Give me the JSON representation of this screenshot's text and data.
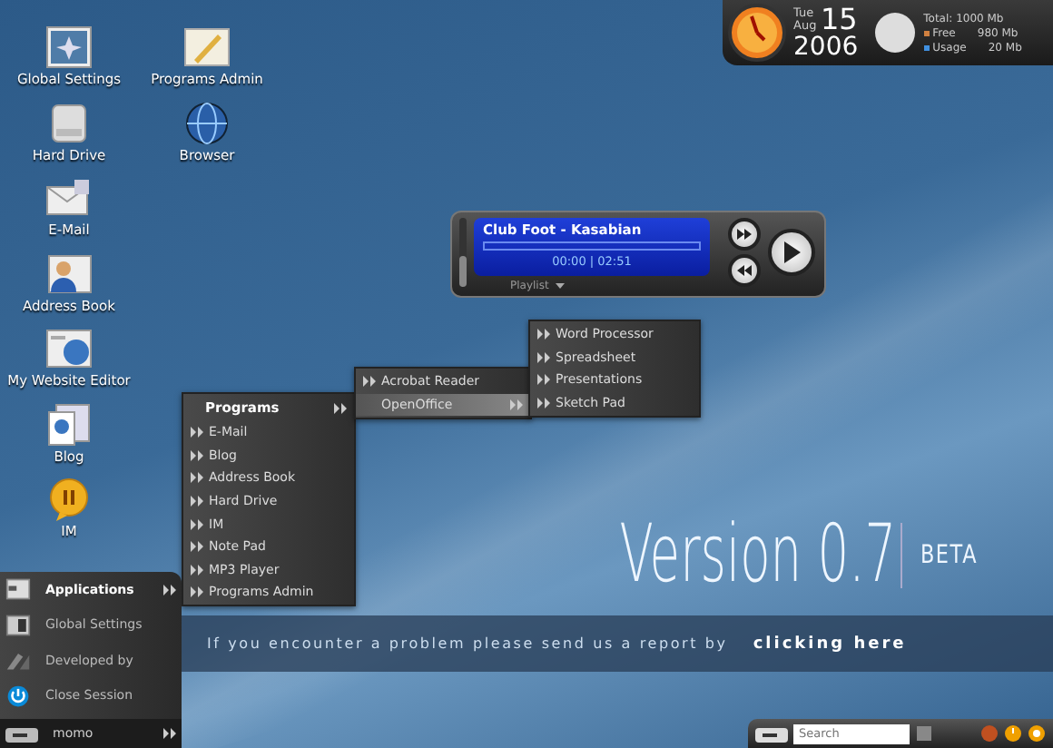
{
  "desktop_icons": [
    {
      "label": "Global Settings",
      "kind": "settings"
    },
    {
      "label": "Hard Drive",
      "kind": "drive"
    },
    {
      "label": "E-Mail",
      "kind": "mail"
    },
    {
      "label": "Address Book",
      "kind": "contacts"
    },
    {
      "label": "My Website Editor",
      "kind": "web"
    },
    {
      "label": "Blog",
      "kind": "blog"
    },
    {
      "label": "IM",
      "kind": "chat"
    },
    {
      "label": "Programs Admin",
      "kind": "admin"
    },
    {
      "label": "Browser",
      "kind": "browser"
    }
  ],
  "clock": {
    "weekday": "Tue",
    "month": "Aug",
    "day": "15",
    "year": "2006"
  },
  "memory": {
    "total": "Total: 1000 Mb",
    "rows": [
      {
        "label": "Free",
        "value": "980 Mb",
        "color": "#d08040"
      },
      {
        "label": "Usage",
        "value": "20 Mb",
        "color": "#4090e0"
      }
    ]
  },
  "player": {
    "track": "Club Foot - Kasabian",
    "time": "00:00 | 02:51",
    "playlist": "Playlist",
    "progress": {
      "level": 0
    },
    "volume": {
      "level": 0.45
    }
  },
  "programs_menu": {
    "title": "Programs",
    "items": [
      "E-Mail",
      "Blog",
      "Address Book",
      "Hard Drive",
      "IM",
      "Note Pad",
      "MP3 Player",
      "Programs Admin"
    ]
  },
  "submenu": {
    "items": [
      {
        "label": "Acrobat Reader",
        "selected": false
      },
      {
        "label": "OpenOffice",
        "selected": true
      }
    ]
  },
  "office_menu": {
    "items": [
      "Word Processor",
      "Spreadsheet",
      "Presentations",
      "Sketch Pad"
    ]
  },
  "start_menu": {
    "items": [
      {
        "label": "Applications",
        "kind": "apps",
        "selected": true
      },
      {
        "label": "Global Settings",
        "kind": "settings",
        "selected": false
      },
      {
        "label": "Developed by",
        "kind": "dev",
        "selected": false
      },
      {
        "label": "Close Session",
        "kind": "power",
        "selected": false
      }
    ],
    "user": "momo"
  },
  "version": {
    "title": "Version 0.7",
    "tag": "BETA"
  },
  "banner": {
    "message": "If you encounter a problem please send us a report by",
    "link": "clicking here"
  },
  "taskbar": {
    "search_placeholder": "Search"
  }
}
